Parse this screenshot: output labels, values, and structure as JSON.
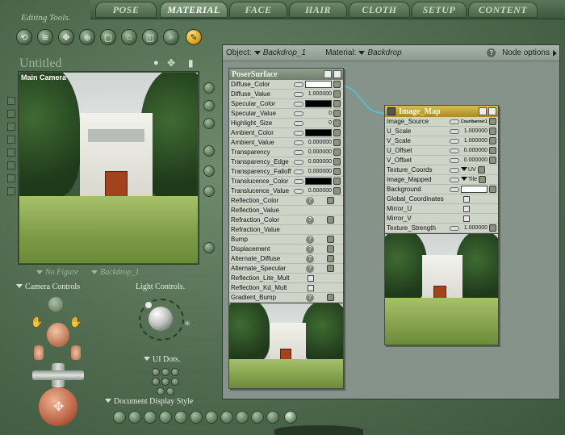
{
  "tabs": [
    "POSE",
    "MATERIAL",
    "FACE",
    "HAIR",
    "CLOTH",
    "SETUP",
    "CONTENT"
  ],
  "active_tab": "MATERIAL",
  "editing_tools_label": "Editing Tools.",
  "document": {
    "title": "Untitled",
    "camera_label": "Main Camera",
    "figure_selector": "No Figure",
    "object_selector": "Backdrop_1"
  },
  "left_panel": {
    "camera_controls_label": "Camera Controls",
    "light_controls_label": "Light Controls.",
    "ui_dots_label": "UI Dots.",
    "document_display_style_label": "Document Display Style"
  },
  "node_editor": {
    "object_label": "Object:",
    "object_value": "Backdrop_1",
    "material_label": "Material:",
    "material_value": "Backdrop",
    "help_glyph": "?",
    "node_options_label": "Node options"
  },
  "poser_surface": {
    "title": "PoserSurface",
    "rows": [
      {
        "name": "Diffuse_Color",
        "kind": "color",
        "color": "#ffffff"
      },
      {
        "name": "Diffuse_Value",
        "kind": "num",
        "value": "1.000000"
      },
      {
        "name": "Specular_Color",
        "kind": "color",
        "color": "#000000"
      },
      {
        "name": "Specular_Value",
        "kind": "num",
        "value": "0"
      },
      {
        "name": "Highlight_Size",
        "kind": "num",
        "value": "0"
      },
      {
        "name": "Ambient_Color",
        "kind": "color",
        "color": "#000000"
      },
      {
        "name": "Ambient_Value",
        "kind": "num",
        "value": "0.000000"
      },
      {
        "name": "Transparency",
        "kind": "num",
        "value": "0.000000"
      },
      {
        "name": "Transparency_Edge",
        "kind": "num",
        "value": "0.000000"
      },
      {
        "name": "Transparency_Falloff",
        "kind": "num",
        "value": "0.000000"
      },
      {
        "name": "Translucence_Color",
        "kind": "color",
        "color": "#000000"
      },
      {
        "name": "Translucence_Value",
        "kind": "num",
        "value": "0.000000"
      },
      {
        "name": "Reflection_Color",
        "kind": "q"
      },
      {
        "name": "Reflection_Value",
        "kind": "none"
      },
      {
        "name": "Refraction_Color",
        "kind": "q"
      },
      {
        "name": "Refraction_Value",
        "kind": "none"
      },
      {
        "name": "Bump",
        "kind": "q"
      },
      {
        "name": "Displacement",
        "kind": "q"
      },
      {
        "name": "Alternate_Diffuse",
        "kind": "q"
      },
      {
        "name": "Alternate_Specular",
        "kind": "q"
      },
      {
        "name": "Reflection_Lite_Mult",
        "kind": "chk"
      },
      {
        "name": "Reflection_Kd_Mult",
        "kind": "chk"
      },
      {
        "name": "Gradient_Bump",
        "kind": "q"
      }
    ]
  },
  "image_map": {
    "title": "Image_Map",
    "rows": [
      {
        "name": "Image_Source",
        "kind": "text",
        "value": "Courtbanner1"
      },
      {
        "name": "U_Scale",
        "kind": "num",
        "value": "1.000000"
      },
      {
        "name": "V_Scale",
        "kind": "num",
        "value": "1.000000"
      },
      {
        "name": "U_Offset",
        "kind": "num",
        "value": "0.000000"
      },
      {
        "name": "V_Offset",
        "kind": "num",
        "value": "0.000000"
      },
      {
        "name": "Texture_Coords",
        "kind": "dd",
        "value": "UV"
      },
      {
        "name": "Image_Mapped",
        "kind": "dd",
        "value": "Tile"
      },
      {
        "name": "Background",
        "kind": "color",
        "color": "#ffffff"
      },
      {
        "name": "Global_Coordinates",
        "kind": "chk"
      },
      {
        "name": "Mirror_U",
        "kind": "chk"
      },
      {
        "name": "Mirror_V",
        "kind": "chk"
      },
      {
        "name": "Texture_Strength",
        "kind": "num",
        "value": "1.000000"
      }
    ]
  }
}
